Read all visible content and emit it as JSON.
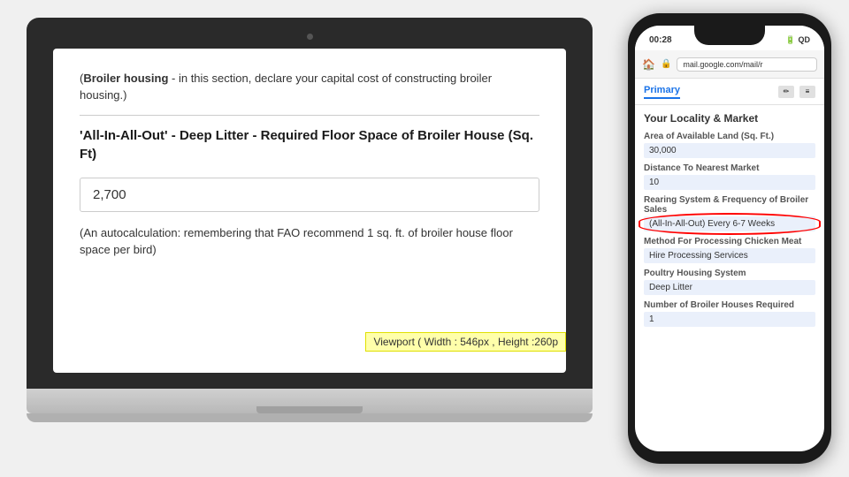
{
  "laptop": {
    "section_header_bold": "Broiler housing",
    "section_header_text": " - in this section, declare your capital cost of constructing broiler housing.)",
    "section_header_prefix": "(",
    "question_label": "'All-In-All-Out' - Deep Litter - Required Floor Space of Broiler House (Sq. Ft)",
    "input_value": "2,700",
    "note_text": "(An autocalculation: remembering that FAO recommend 1 sq. ft. of broiler house floor space per bird)",
    "viewport_tag": "Viewport ( Width : 546px , Height :260p"
  },
  "phone": {
    "status_time": "00:28",
    "status_icons": [
      "🔋",
      "📶"
    ],
    "address_url": "mail.google.com/mail/r",
    "tab_primary": "Primary",
    "email_sender": "Your Locality & Market",
    "fields": [
      {
        "label": "Area of Available Land (Sq. Ft.)",
        "value": "30,000"
      },
      {
        "label": "Distance To Nearest Market",
        "value": "10"
      },
      {
        "label": "Rearing System & Frequency of Broiler Sales",
        "value": "(All-In-All-Out) Every 6-7 Weeks",
        "highlighted": true
      },
      {
        "label": "Method For Processing Chicken Meat",
        "value": "Hire Processing Services"
      },
      {
        "label": "Poultry Housing System",
        "value": "Deep Litter"
      },
      {
        "label": "Number of Broiler Houses Required",
        "value": "1"
      }
    ]
  }
}
